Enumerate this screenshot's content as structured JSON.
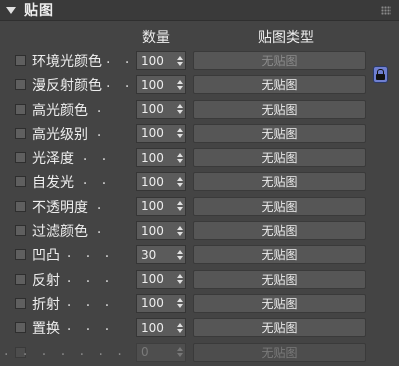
{
  "panel": {
    "title": "贴图"
  },
  "columns": {
    "quantity": "数量",
    "map_type": "贴图类型"
  },
  "rows": [
    {
      "label": "环境光颜色",
      "dots": ". .",
      "value": "100",
      "map": "无贴图",
      "map_dim": true
    },
    {
      "label": "漫反射颜色",
      "dots": ". .",
      "value": "100",
      "map": "无贴图",
      "map_dim": false
    },
    {
      "label": "高光颜色",
      "dots": ". .",
      "value": "100",
      "map": "无贴图",
      "map_dim": false
    },
    {
      "label": "高光级别",
      "dots": ". .",
      "value": "100",
      "map": "无贴图",
      "map_dim": false
    },
    {
      "label": "光泽度",
      "dots": ". . .",
      "value": "100",
      "map": "无贴图",
      "map_dim": false
    },
    {
      "label": "自发光",
      "dots": ". . .",
      "value": "100",
      "map": "无贴图",
      "map_dim": false
    },
    {
      "label": "不透明度",
      "dots": ". .",
      "value": "100",
      "map": "无贴图",
      "map_dim": false
    },
    {
      "label": "过滤颜色",
      "dots": ". .",
      "value": "100",
      "map": "无贴图",
      "map_dim": false
    },
    {
      "label": "凹凸",
      "dots": ". . . .",
      "value": "30",
      "map": "无贴图",
      "map_dim": false
    },
    {
      "label": "反射",
      "dots": ". . . .",
      "value": "100",
      "map": "无贴图",
      "map_dim": false
    },
    {
      "label": "折射",
      "dots": ". . . .",
      "value": "100",
      "map": "无贴图",
      "map_dim": false
    },
    {
      "label": "置换",
      "dots": ". . . .",
      "value": "100",
      "map": "无贴图",
      "map_dim": false
    },
    {
      "label": "",
      "dots": ". . . . . . .",
      "value": "0",
      "map": "无贴图",
      "map_dim": true,
      "disabled": true
    }
  ]
}
